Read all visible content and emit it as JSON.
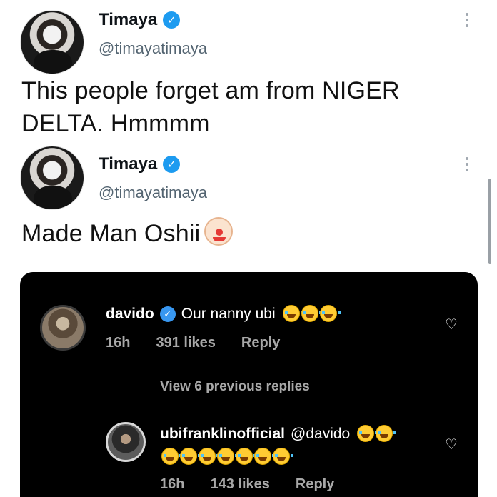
{
  "tweets": [
    {
      "name": "Timaya",
      "handle": "@timayatimaya",
      "text_line1": "This people forget am from NIGER",
      "text_line2": "DELTA. Hmmmm"
    },
    {
      "name": "Timaya",
      "handle": "@timayatimaya",
      "text": "Made Man Oshii"
    }
  ],
  "icons": {
    "verified": "verified-check-icon",
    "more": "more-vertical-icon",
    "clown": "clown-face-emoji",
    "laugh": "tears-of-joy-emoji",
    "heart": "heart-outline-icon"
  },
  "colors": {
    "verified_blue": "#1d9bf0",
    "ig_background": "#000000",
    "ig_meta": "#a8a8a8"
  },
  "instagram": {
    "comment1": {
      "username": "davido",
      "text": "Our nanny ubi",
      "time": "16h",
      "likes": "391 likes",
      "reply": "Reply"
    },
    "view_replies": "View 6 previous replies",
    "comment2": {
      "username": "ubifranklinofficial",
      "mention": "@davido",
      "time": "16h",
      "likes": "143 likes",
      "reply": "Reply"
    }
  }
}
